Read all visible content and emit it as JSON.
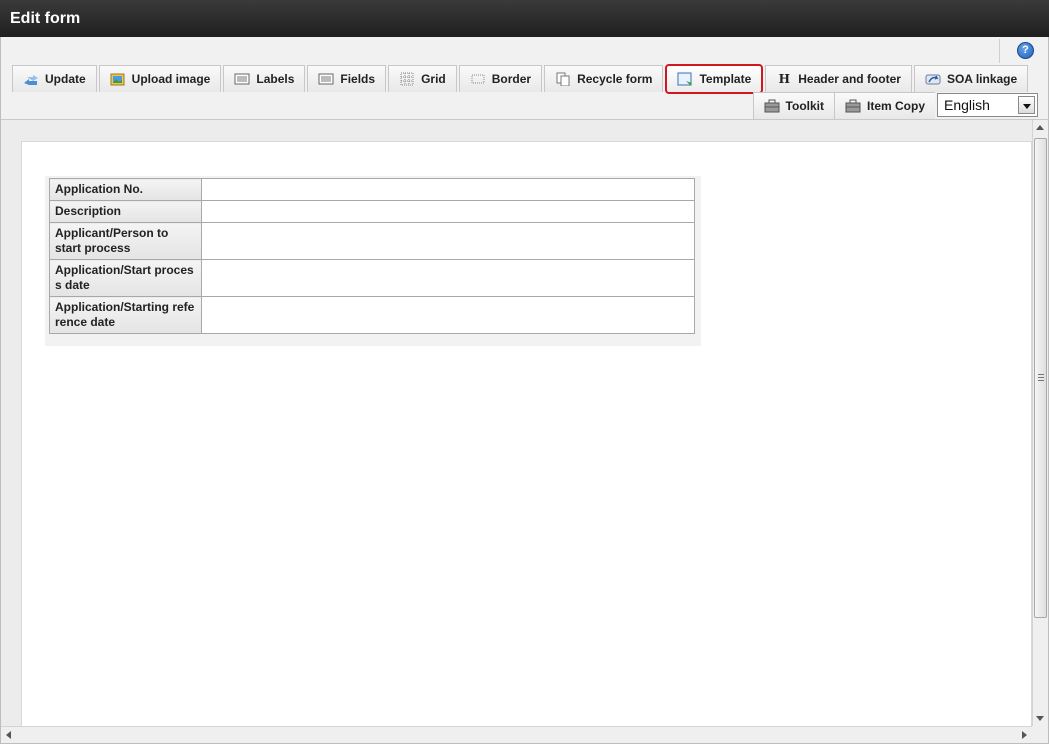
{
  "window": {
    "title": "Edit form"
  },
  "help": {
    "glyph": "?"
  },
  "toolbar": {
    "row1": [
      {
        "name": "update",
        "label": "Update",
        "icon": "update-icon"
      },
      {
        "name": "upload-image",
        "label": "Upload image",
        "icon": "upload-image-icon"
      },
      {
        "name": "labels",
        "label": "Labels",
        "icon": "labels-icon"
      },
      {
        "name": "fields",
        "label": "Fields",
        "icon": "fields-icon"
      },
      {
        "name": "grid",
        "label": "Grid",
        "icon": "grid-icon"
      },
      {
        "name": "border",
        "label": "Border",
        "icon": "border-icon"
      },
      {
        "name": "recycle-form",
        "label": "Recycle form",
        "icon": "recycle-form-icon"
      },
      {
        "name": "template",
        "label": "Template",
        "icon": "template-icon",
        "highlighted": true
      },
      {
        "name": "header-footer",
        "label": "Header and footer",
        "icon": "header-footer-icon"
      },
      {
        "name": "soa-linkage",
        "label": "SOA linkage",
        "icon": "soa-linkage-icon"
      }
    ],
    "row2": [
      {
        "name": "toolkit",
        "label": "Toolkit",
        "icon": "toolkit-icon"
      },
      {
        "name": "item-copy",
        "label": "Item Copy",
        "icon": "item-copy-icon"
      }
    ],
    "language": {
      "selected": "English"
    },
    "highlight_color": "#d0181e"
  },
  "form": {
    "rows": [
      {
        "label": "Application No.",
        "value": ""
      },
      {
        "label": "Description",
        "value": ""
      },
      {
        "label": "Applicant/Person to start process",
        "value": ""
      },
      {
        "label": "Application/Start proces s date",
        "value": ""
      },
      {
        "label": "Application/Starting refe rence date",
        "value": ""
      }
    ]
  }
}
